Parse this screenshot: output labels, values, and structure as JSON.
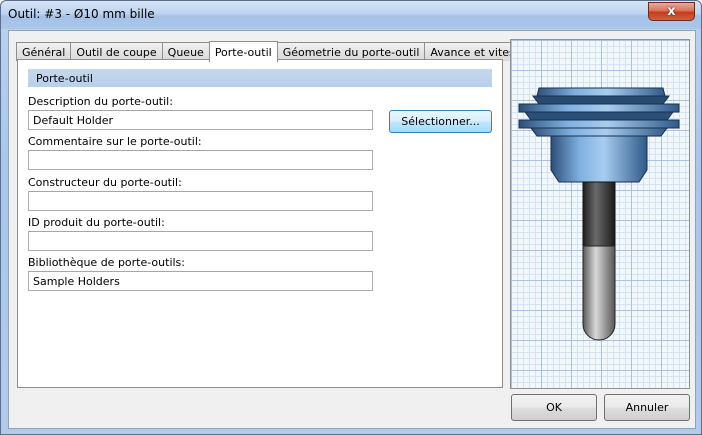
{
  "window": {
    "title": "Outil: #3 - Ø10 mm bille",
    "close_glyph": "x"
  },
  "tabs": [
    {
      "label": "Général",
      "active": false
    },
    {
      "label": "Outil de coupe",
      "active": false
    },
    {
      "label": "Queue",
      "active": false
    },
    {
      "label": "Porte-outil",
      "active": true
    },
    {
      "label": "Géometrie du porte-outil",
      "active": false
    },
    {
      "label": "Avance et vitesse",
      "active": false
    }
  ],
  "section": {
    "title": "Porte-outil"
  },
  "fields": {
    "description": {
      "label": "Description du porte-outil:",
      "value": "Default Holder"
    },
    "comment": {
      "label": "Commentaire sur le porte-outil:",
      "value": ""
    },
    "manufacturer": {
      "label": "Constructeur du porte-outil:",
      "value": ""
    },
    "product_id": {
      "label": "ID produit du porte-outil:",
      "value": ""
    },
    "library": {
      "label": "Bibliothèque de porte-outils:",
      "value": "Sample Holders"
    }
  },
  "buttons": {
    "select": "Sélectionner...",
    "ok": "OK",
    "cancel": "Annuler"
  },
  "colors": {
    "accent": "#3c7fb1",
    "holder_blue": "#6f9fd0",
    "shank_dark": "#3a3a3a"
  },
  "icons": {
    "close": "close-icon",
    "preview": "tool-holder-preview"
  }
}
